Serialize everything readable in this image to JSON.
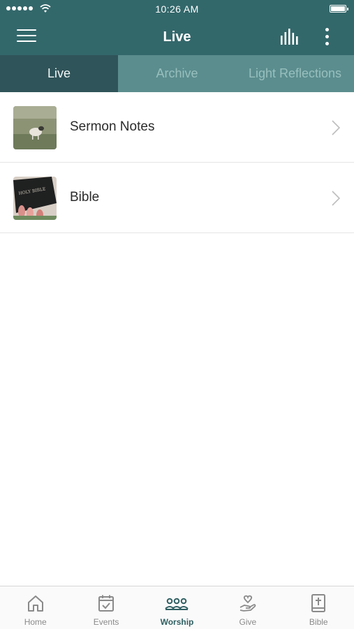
{
  "status_bar": {
    "time": "10:26 AM"
  },
  "header": {
    "title": "Live"
  },
  "tabs": [
    {
      "label": "Live",
      "active": true
    },
    {
      "label": "Archive",
      "active": false
    },
    {
      "label": "Light Reflections",
      "active": false
    }
  ],
  "list": [
    {
      "label": "Sermon Notes",
      "thumbnail": "lamb-in-field"
    },
    {
      "label": "Bible",
      "thumbnail": "holy-bible-with-tulips"
    }
  ],
  "bottom_nav": [
    {
      "label": "Home",
      "icon": "home-icon",
      "active": false
    },
    {
      "label": "Events",
      "icon": "calendar-check-icon",
      "active": false
    },
    {
      "label": "Worship",
      "icon": "people-group-icon",
      "active": true
    },
    {
      "label": "Give",
      "icon": "hand-heart-icon",
      "active": false
    },
    {
      "label": "Bible",
      "icon": "bible-icon",
      "active": false
    }
  ],
  "colors": {
    "header_bg": "#33686b",
    "active_tab_bg": "#2f5459",
    "inactive_tab_bg": "#5b8d8e",
    "active_nav": "#2f5f62"
  }
}
